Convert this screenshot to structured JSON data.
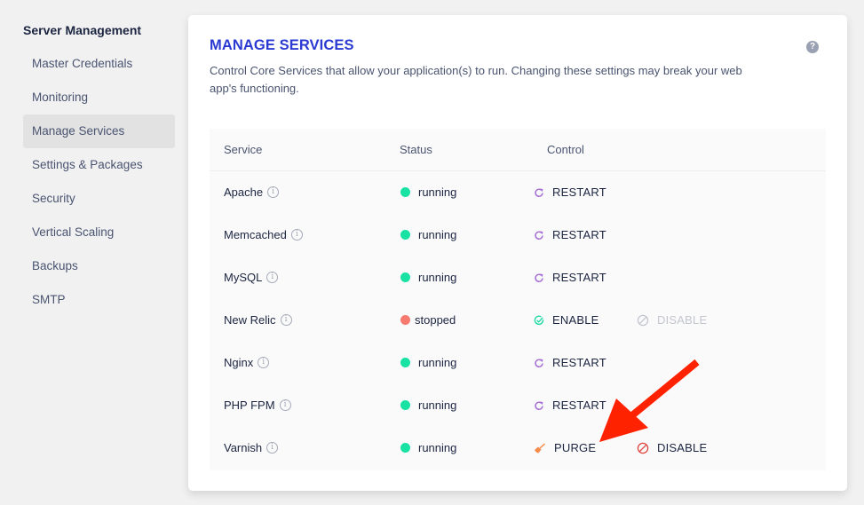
{
  "sidebar": {
    "title": "Server Management",
    "items": [
      {
        "label": "Master Credentials",
        "active": false
      },
      {
        "label": "Monitoring",
        "active": false
      },
      {
        "label": "Manage Services",
        "active": true
      },
      {
        "label": "Settings & Packages",
        "active": false
      },
      {
        "label": "Security",
        "active": false
      },
      {
        "label": "Vertical Scaling",
        "active": false
      },
      {
        "label": "Backups",
        "active": false
      },
      {
        "label": "SMTP",
        "active": false
      }
    ]
  },
  "card": {
    "title": "MANAGE SERVICES",
    "description": "Control Core Services that allow your application(s) to run. Changing these settings may break your web app's functioning.",
    "help_icon": "?"
  },
  "table": {
    "headers": {
      "service": "Service",
      "status": "Status",
      "control": "Control"
    },
    "rows": [
      {
        "service": "Apache",
        "status": "running",
        "actions": [
          {
            "label": "RESTART",
            "icon": "restart-icon",
            "enabled": true
          }
        ]
      },
      {
        "service": "Memcached",
        "status": "running",
        "actions": [
          {
            "label": "RESTART",
            "icon": "restart-icon",
            "enabled": true
          }
        ]
      },
      {
        "service": "MySQL",
        "status": "running",
        "actions": [
          {
            "label": "RESTART",
            "icon": "restart-icon",
            "enabled": true
          }
        ]
      },
      {
        "service": "New Relic",
        "status": "stopped",
        "actions": [
          {
            "label": "ENABLE",
            "icon": "check-circle-icon",
            "enabled": true
          },
          {
            "label": "DISABLE",
            "icon": "ban-icon",
            "enabled": false
          }
        ]
      },
      {
        "service": "Nginx",
        "status": "running",
        "actions": [
          {
            "label": "RESTART",
            "icon": "restart-icon",
            "enabled": true
          }
        ]
      },
      {
        "service": "PHP FPM",
        "status": "running",
        "actions": [
          {
            "label": "RESTART",
            "icon": "restart-icon",
            "enabled": true
          }
        ]
      },
      {
        "service": "Varnish",
        "status": "running",
        "actions": [
          {
            "label": "PURGE",
            "icon": "broom-icon",
            "enabled": true
          },
          {
            "label": "DISABLE",
            "icon": "ban-icon",
            "enabled": true
          }
        ]
      }
    ]
  },
  "colors": {
    "accent": "#2b3bd1",
    "running": "#17e2a3",
    "stopped": "#f67a70",
    "restart_icon": "#a46fd6",
    "enable_icon": "#17d9a0",
    "disable_icon": "#e0453c",
    "purge_icon": "#f58a4a",
    "annotation_arrow": "#ff2200"
  }
}
